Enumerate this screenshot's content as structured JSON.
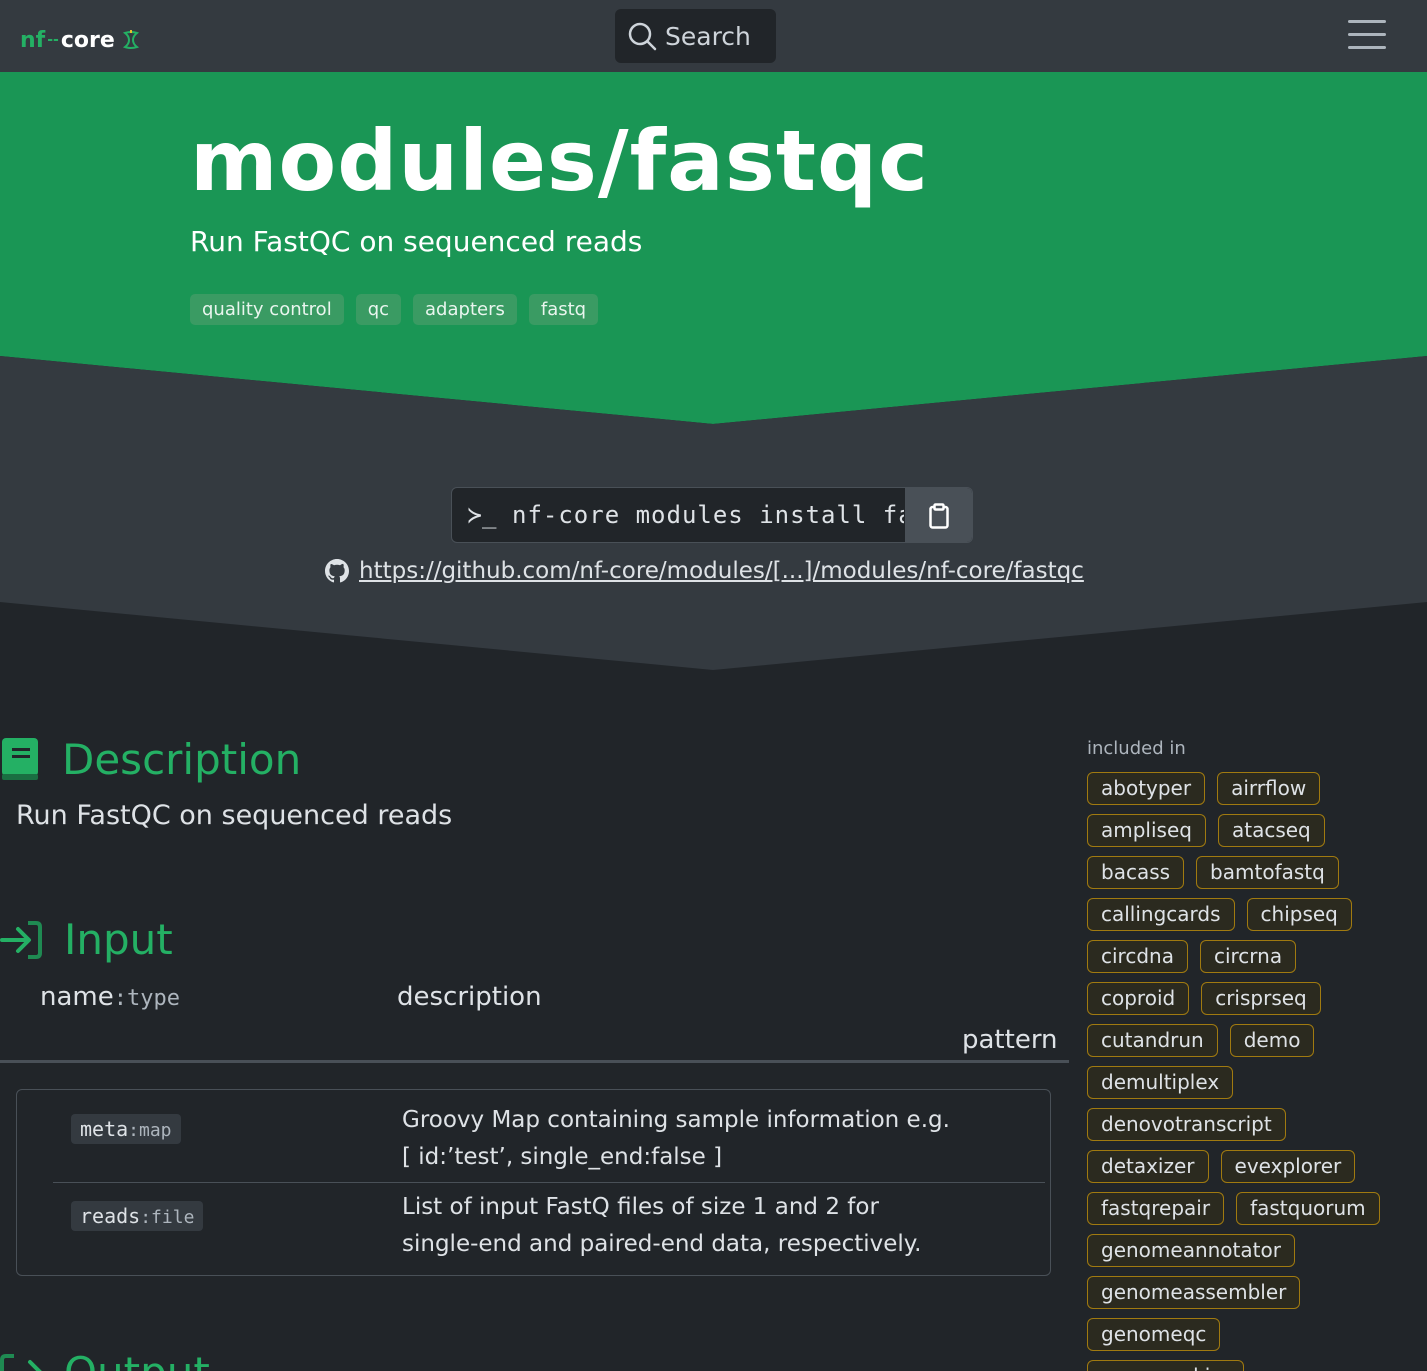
{
  "nav": {
    "logo_prefix": "nf",
    "logo_suffix": "core",
    "search_label": "Search"
  },
  "hero": {
    "title": "modules/fastqc",
    "subtitle": "Run FastQC on sequenced reads",
    "tags": [
      "quality control",
      "qc",
      "adapters",
      "fastq"
    ]
  },
  "install": {
    "prompt": "≻_",
    "command": "nf-core modules install fastqc",
    "github_url": " https://github.com/nf-core/modules/[...]/modules/nf-core/fastqc"
  },
  "description": {
    "heading": "Description",
    "text": "Run FastQC on sequenced reads"
  },
  "input": {
    "heading": "Input",
    "col_name": "name",
    "col_type": ":type",
    "col_description": "description",
    "col_pattern": "pattern",
    "rows": [
      {
        "name": "meta",
        "type": ":map",
        "description": "Groovy Map containing sample information e.g. [ id:’test’, single_end:false ]"
      },
      {
        "name": "reads",
        "type": ":file",
        "description": "List of input FastQ files of size 1 and 2 for single-end and paired-end data, respectively."
      }
    ]
  },
  "output": {
    "heading": "Output"
  },
  "sidebar": {
    "label": "included in",
    "pipelines": [
      "abotyper",
      "airrflow",
      "ampliseq",
      "atacseq",
      "bacass",
      "bamtofastq",
      "callingcards",
      "chipseq",
      "circdna",
      "circrna",
      "coproid",
      "crisprseq",
      "cutandrun",
      "demo",
      "demultiplex",
      "denovotranscript",
      "detaxizer",
      "evexplorer",
      "fastqrepair",
      "fastquorum",
      "genomeannotator",
      "genomeassembler",
      "genomeqc",
      "genomeskim"
    ]
  },
  "colors": {
    "brand_green": "#24b064",
    "hero_green": "#1a9655",
    "pill_border": "#a07a10"
  }
}
